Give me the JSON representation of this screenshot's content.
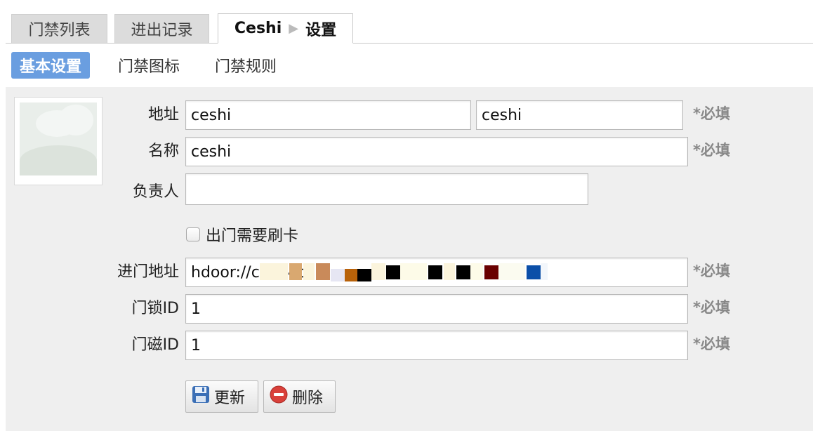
{
  "tabs": {
    "list": "门禁列表",
    "records": "进出记录",
    "current_name": "Ceshi",
    "current_separator": "▶",
    "current_section": "设置"
  },
  "subtabs": {
    "basic": "基本设置",
    "icon": "门禁图标",
    "rules": "门禁规则"
  },
  "form": {
    "address_label": "地址",
    "address_value_1": "ceshi",
    "address_value_2": "ceshi",
    "name_label": "名称",
    "name_value": "ceshi",
    "owner_label": "负责人",
    "owner_value": "",
    "exit_card_label": "出门需要刷卡",
    "exit_card_checked": false,
    "entry_address_label": "进门地址",
    "entry_address_value": "hdoor://c1bc4ca",
    "lock_id_label": "门锁ID",
    "lock_id_value": "1",
    "magnet_id_label": "门磁ID",
    "magnet_id_value": "1",
    "required_text": "*必填"
  },
  "buttons": {
    "update": "更新",
    "delete": "删除"
  },
  "colors": {
    "active_subtab": "#6a9ee0",
    "panel_bg": "#efefef",
    "required": "#888888"
  }
}
